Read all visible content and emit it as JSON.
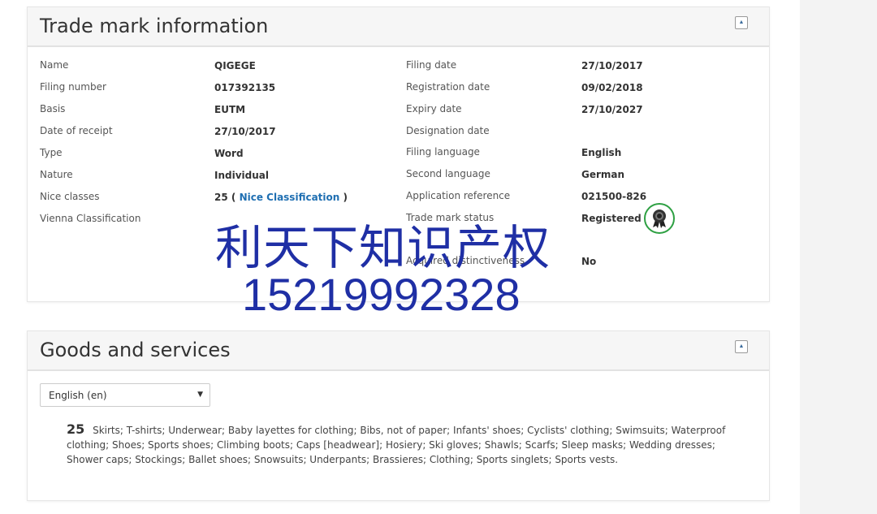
{
  "trademark_panel": {
    "title": "Trade mark information",
    "left": [
      {
        "label": "Name",
        "value": "QIGEGE"
      },
      {
        "label": "Filing number",
        "value": "017392135"
      },
      {
        "label": "Basis",
        "value": "EUTM"
      },
      {
        "label": "Date of receipt",
        "value": "27/10/2017"
      },
      {
        "label": "Type",
        "value": "Word"
      },
      {
        "label": "Nature",
        "value": "Individual"
      },
      {
        "label": "Nice classes",
        "value": "25 (",
        "link": "Nice Classification",
        "suffix": ")"
      },
      {
        "label": "Vienna Classification",
        "value": ""
      }
    ],
    "right": [
      {
        "label": "Filing date",
        "value": "27/10/2017"
      },
      {
        "label": "Registration date",
        "value": "09/02/2018"
      },
      {
        "label": "Expiry date",
        "value": "27/10/2027"
      },
      {
        "label": "Designation date",
        "value": ""
      },
      {
        "label": "Filing language",
        "value": "English"
      },
      {
        "label": "Second language",
        "value": "German"
      },
      {
        "label": "Application reference",
        "value": "021500-826"
      },
      {
        "label": "Trade mark status",
        "value": "Registered"
      },
      {
        "label": "Acquired distinctiveness",
        "value": "No"
      }
    ],
    "status_icon": "ribbon-award-icon",
    "status_color": "#2ea043"
  },
  "watermark": {
    "chinese": "利天下知识产权",
    "phone": "15219992328",
    "color": "#1f2fa5"
  },
  "goods_panel": {
    "title": "Goods and services",
    "language_select": "English (en)",
    "class_number": "25",
    "goods_text": "Skirts; T-shirts; Underwear; Baby layettes for clothing; Bibs, not of paper; Infants' shoes; Cyclists' clothing; Swimsuits; Waterproof clothing; Shoes; Sports shoes; Climbing boots; Caps [headwear]; Hosiery; Ski gloves; Shawls; Scarfs; Sleep masks; Wedding dresses; Shower caps; Stockings; Ballet shoes; Snowsuits; Underpants; Brassieres; Clothing; Sports singlets; Sports vests."
  }
}
